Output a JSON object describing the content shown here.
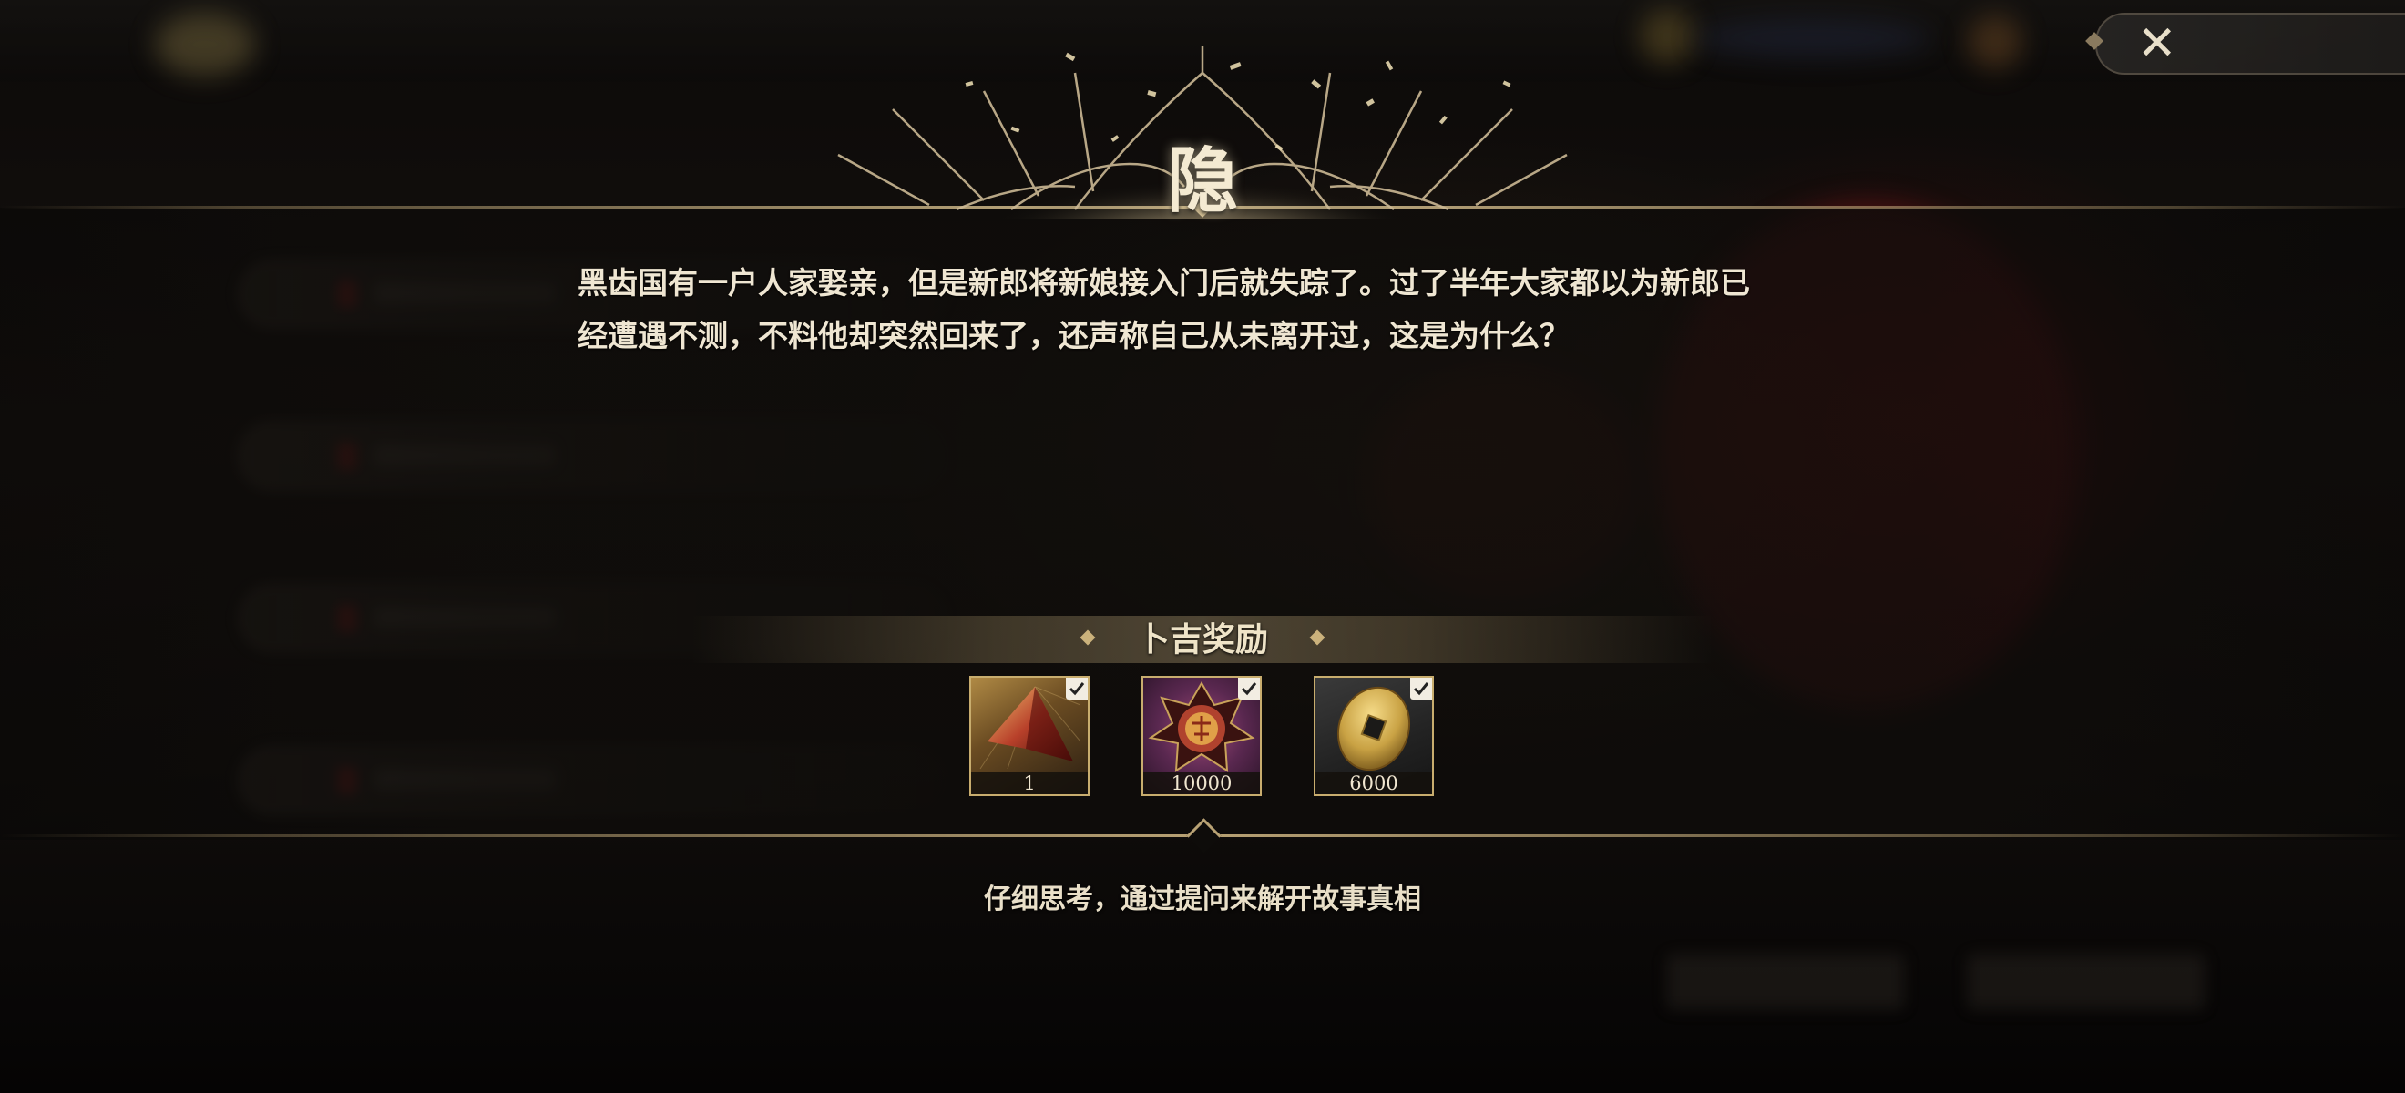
{
  "header": {
    "title": "隐",
    "close_icon": "close-x-icon"
  },
  "story": {
    "line1": "黑齿国有一户人家娶亲，但是新郎将新娘接入门后就失踪了。过了半年大家都以为新郎已",
    "line2": "经遭遇不测，不料他却突然回来了，还声称自己从未离开过，这是为什么？"
  },
  "rewards": {
    "title": "卜吉奖励",
    "items": [
      {
        "icon": "crystal-shard-icon",
        "quantity": "1",
        "checked": true
      },
      {
        "icon": "seal-emblem-icon",
        "quantity": "10000",
        "checked": true
      },
      {
        "icon": "coin-icon",
        "quantity": "6000",
        "checked": true
      }
    ]
  },
  "hint": "仔细思考，通过提问来解开故事真相",
  "colors": {
    "accent_gold": "#cdb788",
    "text": "#efe6d2",
    "bg_red_glow": "#6e1214"
  }
}
